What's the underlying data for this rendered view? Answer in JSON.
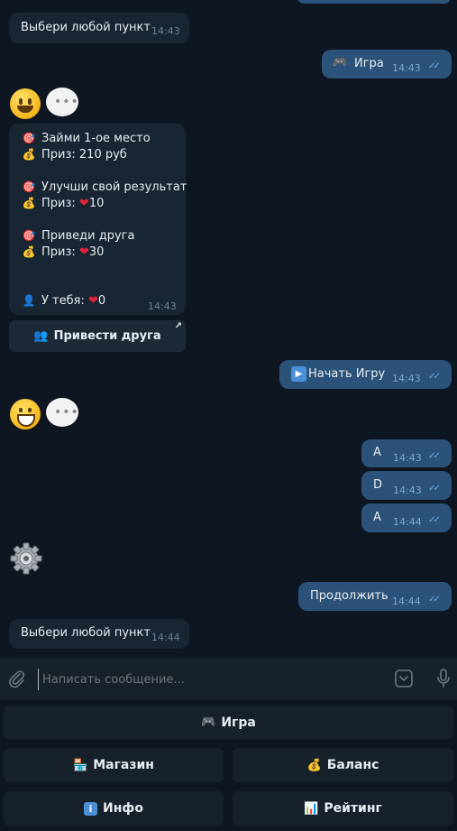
{
  "messages": [
    {
      "text": "Выбери любой пункт",
      "time": "14:43"
    },
    {
      "icon": "gamepad-icon",
      "text": "Игра",
      "time": "14:43"
    },
    {
      "lines": [
        {
          "icon": "target-icon",
          "text": "Займи 1-ое место"
        },
        {
          "icon": "money-bag-icon",
          "text": "Приз: 210 руб"
        },
        {
          "icon": "target-icon",
          "text": "Улучши свой результат"
        },
        {
          "icon": "money-bag-icon",
          "prefix": "Приз: ",
          "heart": "❤",
          "value": "10"
        },
        {
          "icon": "target-icon",
          "text": "Приведи друга"
        },
        {
          "icon": "money-bag-icon",
          "prefix": "Приз: ",
          "heart": "❤",
          "value": "30"
        },
        {
          "icon": "user-icon",
          "prefix": "У тебя: ",
          "heart": "❤",
          "value": "0"
        }
      ],
      "time": "14:43"
    },
    {
      "icon": "play-icon",
      "text": "Начать Игру",
      "time": "14:43"
    },
    {
      "text": "A",
      "time": "14:43"
    },
    {
      "text": "D",
      "time": "14:43"
    },
    {
      "text": "A",
      "time": "14:44"
    },
    {
      "text": "Продолжить",
      "time": "14:44"
    },
    {
      "text": "Выбери любой пункт",
      "time": "14:44"
    }
  ],
  "inline_button": {
    "icon": "people-icon",
    "label": "Привести друга"
  },
  "composer": {
    "placeholder": "Написать сообщение..."
  },
  "keyboard": {
    "game": {
      "icon": "gamepad-icon",
      "label": "Игра"
    },
    "shop": {
      "icon": "shop-icon",
      "label": "Магазин"
    },
    "balance": {
      "icon": "money-bag-icon",
      "label": "Баланс"
    },
    "info": {
      "icon": "info-icon",
      "label": "Инфо"
    },
    "rating": {
      "icon": "chart-icon",
      "label": "Рейтинг"
    }
  },
  "colors": {
    "background": "#0e1621",
    "incoming": "#182533",
    "outgoing": "#2b5278",
    "read_ticks": "#6ab3f3"
  }
}
